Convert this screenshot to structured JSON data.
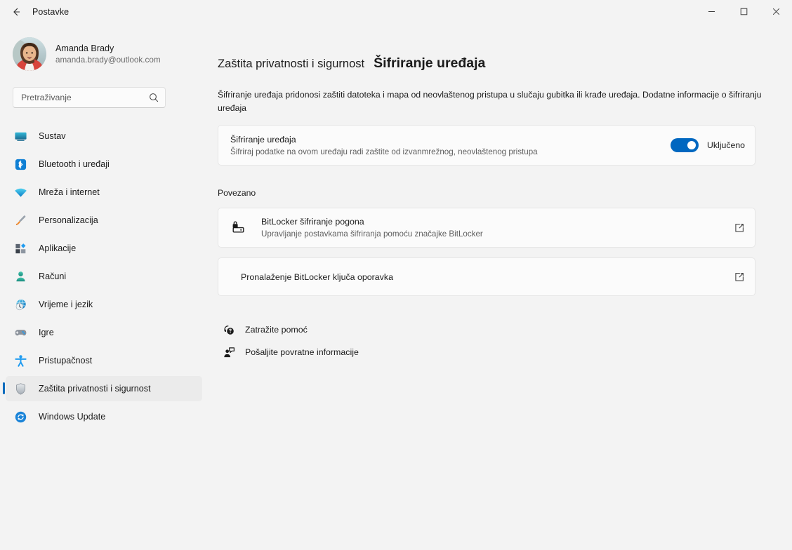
{
  "window": {
    "app_title": "Postavke",
    "back_icon": "arrow-left-icon",
    "minimize_label": "─",
    "maximize_label": "□",
    "close_label": "✕"
  },
  "sidebar": {
    "profile": {
      "name": "Amanda Brady",
      "email": "amanda.brady@outlook.com"
    },
    "search": {
      "placeholder": "Pretraživanje",
      "value": "",
      "icon": "search-icon"
    },
    "items": [
      {
        "label": "Sustav",
        "icon": "system-monitor-icon",
        "selected": false
      },
      {
        "label": "Bluetooth i uređaji",
        "icon": "bluetooth-icon",
        "selected": false
      },
      {
        "label": "Mreža i internet",
        "icon": "wifi-icon",
        "selected": false
      },
      {
        "label": "Personalizacija",
        "icon": "paintbrush-icon",
        "selected": false
      },
      {
        "label": "Aplikacije",
        "icon": "apps-icon",
        "selected": false
      },
      {
        "label": "Računi",
        "icon": "accounts-person-icon",
        "selected": false
      },
      {
        "label": "Vrijeme i jezik",
        "icon": "time-language-globe-icon",
        "selected": false
      },
      {
        "label": "Igre",
        "icon": "gamepad-icon",
        "selected": false
      },
      {
        "label": "Pristupačnost",
        "icon": "accessibility-icon",
        "selected": false
      },
      {
        "label": "Zaštita privatnosti i sigurnost",
        "icon": "shield-icon",
        "selected": true
      },
      {
        "label": "Windows Update",
        "icon": "update-refresh-icon",
        "selected": false
      }
    ]
  },
  "main": {
    "breadcrumb": "Zaštita privatnosti i sigurnost",
    "page_title": "Šifriranje uređaja",
    "description": "Šifriranje uređaja pridonosi zaštiti datoteka i mapa od neovlaštenog pristupa u slučaju gubitka ili krađe uređaja. Dodatne informacije o šifriranju uređaja",
    "encryption_toggle": {
      "title": "Šifriranje uređaja",
      "subtitle": "Šifriraj podatke na ovom uređaju radi zaštite od izvanmrežnog, neovlaštenog pristupa",
      "state_label": "Uključeno",
      "on": true,
      "accent_color": "#0067c0"
    },
    "related_label": "Povezano",
    "related_items": [
      {
        "title": "BitLocker šifriranje pogona",
        "subtitle": "Upravljanje postavkama šifriranja pomoću značajke BitLocker",
        "icon": "bitlocker-drive-lock-icon",
        "action_icon": "external-link-icon"
      },
      {
        "title": "Pronalaženje BitLocker ključa oporavka",
        "subtitle": "",
        "icon": "",
        "action_icon": "external-link-icon"
      }
    ],
    "footer_links": [
      {
        "label": "Zatražite pomoć",
        "icon": "help-question-icon"
      },
      {
        "label": "Pošaljite povratne informacije",
        "icon": "feedback-person-icon"
      }
    ]
  }
}
